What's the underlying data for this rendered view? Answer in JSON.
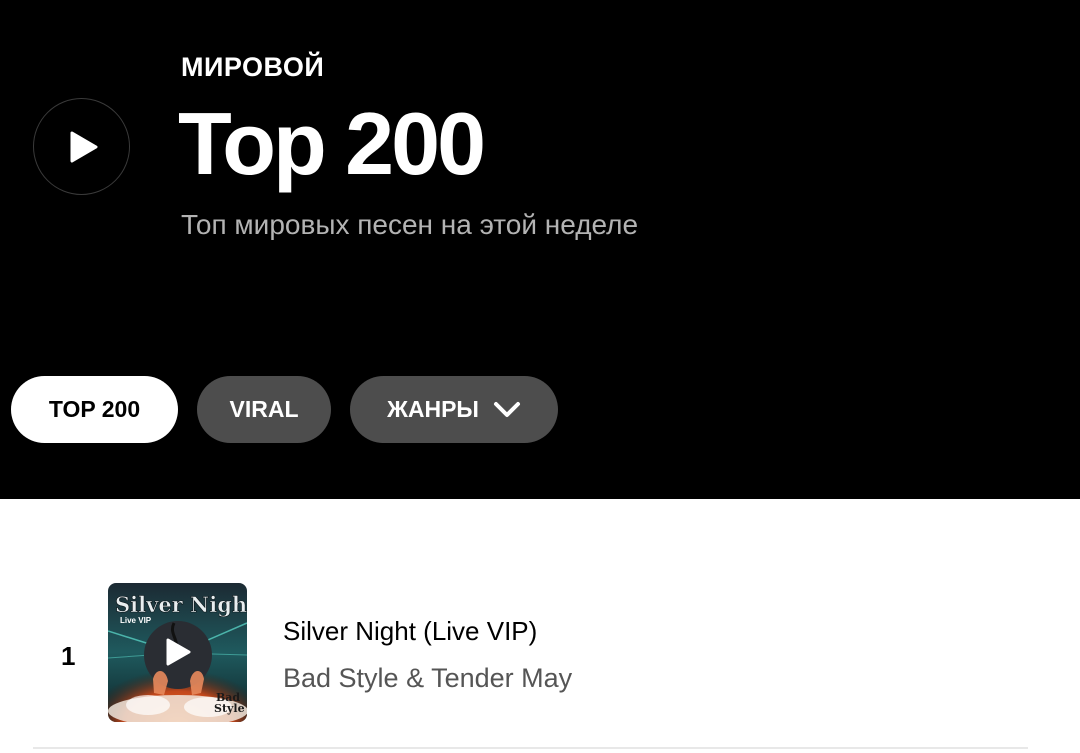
{
  "header": {
    "kicker": "МИРОВОЙ",
    "title": "Top 200",
    "subtitle": "Топ мировых песен на этой неделе",
    "play_icon": "play-icon"
  },
  "tabs": [
    {
      "label": "TOP 200",
      "active": true
    },
    {
      "label": "VIRAL",
      "active": false
    },
    {
      "label": "ЖАНРЫ",
      "active": false,
      "icon": "chevron-down-icon"
    }
  ],
  "tracks": [
    {
      "rank": "1",
      "title": "Silver Night (Live VIP)",
      "artist": "Bad Style & Tender May",
      "cover_title": "Silver Night",
      "cover_subtitle": "Live VIP",
      "cover_logo": "Bad Style"
    }
  ],
  "colors": {
    "hero_bg": "#000000",
    "pill_active_bg": "#ffffff",
    "pill_inactive_bg": "#4d4d4d",
    "subtitle": "#b3b3b3",
    "artist": "#555555"
  }
}
